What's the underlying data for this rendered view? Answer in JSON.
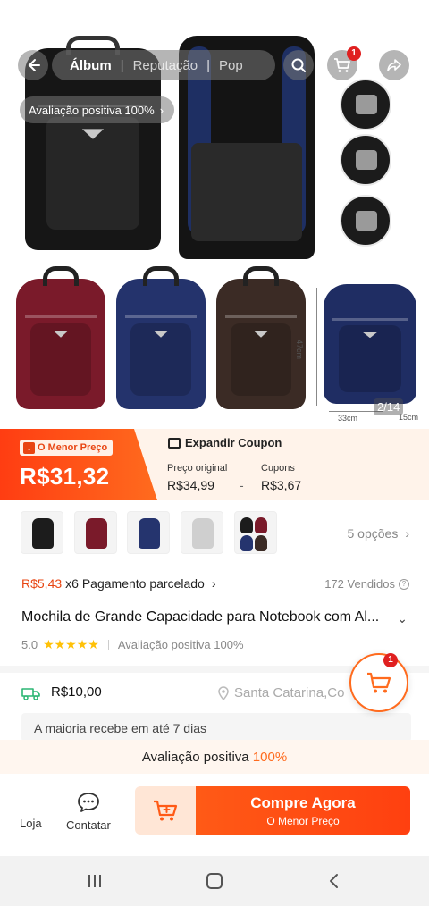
{
  "gallery": {
    "counter": "2/14",
    "dimensions": {
      "height": "47cm",
      "width": "33cm",
      "depth": "15cm"
    },
    "rating_pill": "Avaliação positiva 100%"
  },
  "topbar": {
    "tabs": [
      {
        "label": "Álbum",
        "active": true
      },
      {
        "label": "Reputação",
        "active": false
      },
      {
        "label": "Pop",
        "active": false
      }
    ],
    "cart_badge": "1",
    "icons": [
      "back-arrow-icon",
      "search-icon",
      "cart-icon",
      "share-icon"
    ]
  },
  "price": {
    "low_tag": "O Menor Preço",
    "current": "R$31,32",
    "coupon_title": "Expandir Coupon",
    "original_label": "Preço original",
    "original_value": "R$34,99",
    "coupons_label": "Cupons",
    "coupons_value": "R$3,67",
    "minus": "-",
    "colors": {
      "accent": "#ff5a16",
      "banner_bg": "#fff3ea"
    }
  },
  "variants": {
    "thumbs": [
      {
        "name": "black",
        "color": "#1c1c1c"
      },
      {
        "name": "burgundy",
        "color": "#7a1a2a"
      },
      {
        "name": "navy",
        "color": "#25346e"
      },
      {
        "name": "grey",
        "color": "#cfcfcf"
      },
      {
        "name": "multi",
        "color": "#3a3a3a"
      }
    ],
    "options_label": "5 opções"
  },
  "installment": {
    "amount": "R$5,43",
    "text": "x6 Pagamento parcelado",
    "sold": "172 Vendidos"
  },
  "product": {
    "title": "Mochila de Grande Capacidade para Notebook com Al...",
    "rating": "5.0",
    "stars": "★★★★★",
    "positive": "Avaliação positiva 100%"
  },
  "shipping": {
    "cost": "R$10,00",
    "location": "Santa Catarina,Co",
    "delivery": "A maioria recebe em até 7 dias"
  },
  "float_cart": {
    "badge": "1"
  },
  "bottom": {
    "eval_text": "Avaliação positiva",
    "eval_pct": "100%",
    "store_label": "Loja",
    "contact_label": "Contatar",
    "buy_label": "Compre Agora",
    "buy_sub": "O Menor Preço"
  }
}
